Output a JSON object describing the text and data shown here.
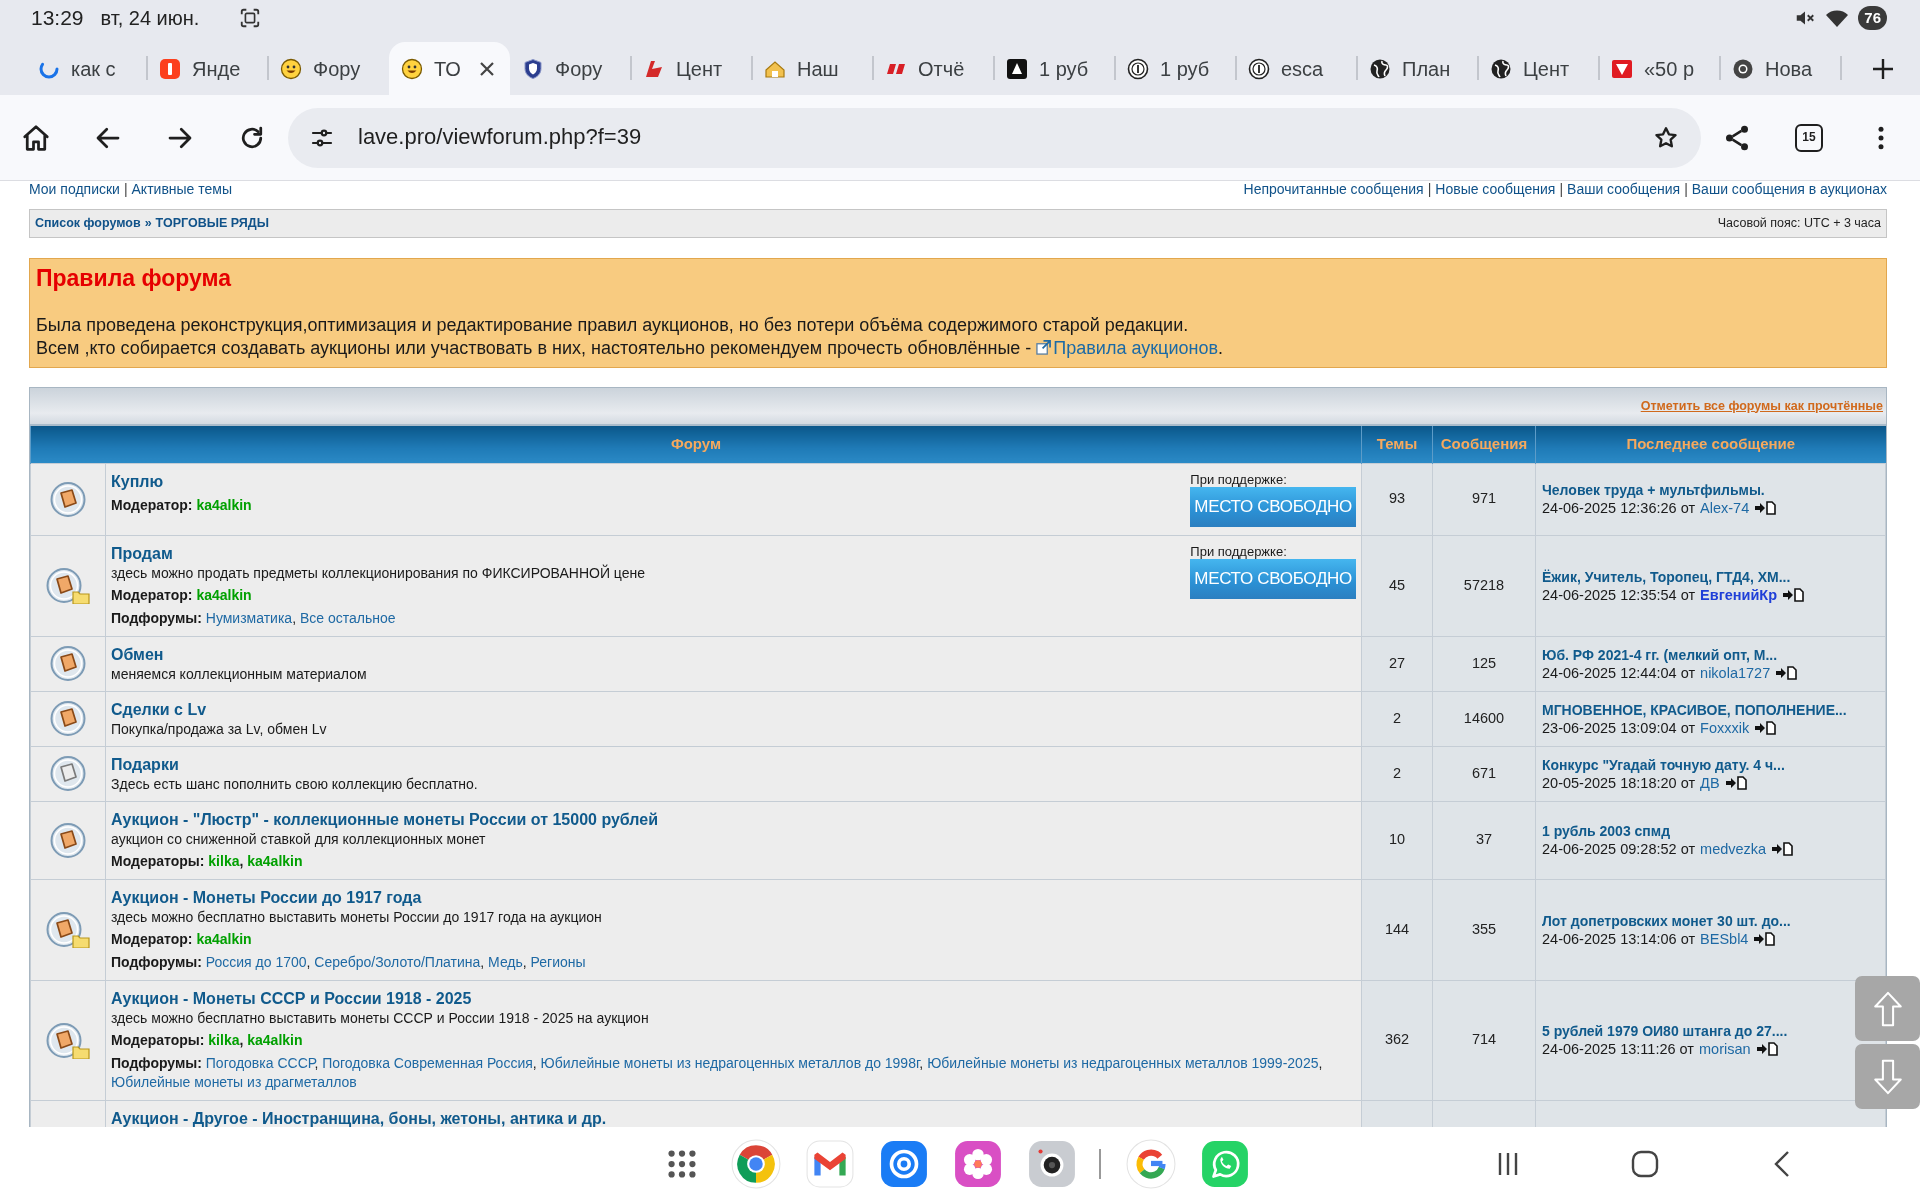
{
  "status_bar": {
    "time": "13:29",
    "date": "вт, 24 июн.",
    "battery": "76"
  },
  "browser": {
    "tabs": [
      {
        "title": "как с",
        "kind": "spinner",
        "selected": false
      },
      {
        "title": "Янде",
        "kind": "red_tile",
        "selected": false
      },
      {
        "title": "Фору",
        "kind": "smiley",
        "selected": false
      },
      {
        "title": "ТО",
        "kind": "smiley",
        "selected": true
      },
      {
        "title": "Фору",
        "kind": "shield",
        "selected": false
      },
      {
        "title": "Цент",
        "kind": "emblem",
        "selected": false
      },
      {
        "title": "Наш",
        "kind": "house",
        "selected": false
      },
      {
        "title": "Отчё",
        "kind": "bars_logo",
        "selected": false
      },
      {
        "title": "1 руб",
        "kind": "dark_tile",
        "selected": false
      },
      {
        "title": "1 руб",
        "kind": "coin",
        "selected": false
      },
      {
        "title": "esca",
        "kind": "coin",
        "selected": false
      },
      {
        "title": "План",
        "kind": "globe",
        "selected": false
      },
      {
        "title": "Цент",
        "kind": "globe",
        "selected": false
      },
      {
        "title": "«50 р",
        "kind": "red_logo",
        "selected": false
      },
      {
        "title": "Нова",
        "kind": "ring_logo",
        "selected": false
      }
    ],
    "url": "lave.pro/viewforum.php?f=39",
    "tab_count": "15"
  },
  "top_links": {
    "left": [
      "Мои подписки",
      "Активные темы"
    ],
    "right": [
      "Непрочитанные сообщения",
      "Новые сообщения",
      "Ваши сообщения",
      "Ваши сообщения в аукционах"
    ],
    "separator": "|"
  },
  "breadcrumb": {
    "items": [
      "Список форумов",
      "ТОРГОВЫЕ РЯДЫ"
    ],
    "separator": "»",
    "timezone": "Часовой пояс: UTC + 3 часа"
  },
  "rules": {
    "title": "Правила форума",
    "paragraphs": [
      {
        "text": "Была проведена реконструкция,оптимизация и редактирование правил аукционов, но без потери объёма содержимого старой редакции."
      },
      {
        "text": "Всем ,кто собирается создавать аукционы или участвовать в них, настоятельно рекомендуем прочесть обновлённые - ",
        "link": "Правила аукционов",
        "after": "."
      }
    ]
  },
  "forum_table": {
    "mark_read": "Отметить все форумы как прочтённые",
    "columns": [
      "Форум",
      "Темы",
      "Сообщения",
      "Последнее сообщение"
    ],
    "separator": ",",
    "rows": [
      {
        "title": "Куплю",
        "unread": true,
        "moderators": {
          "label": "Модератор:",
          "names": [
            "ka4alkin"
          ]
        },
        "sponsor": {
          "label": "При поддержке:",
          "banner": "МЕСТО СВОБОДНО"
        },
        "topics": "93",
        "posts": "971",
        "last_post": {
          "title": "Человек труда + мультфильмы.",
          "time": "24-06-2025 12:36:26 от",
          "author": {
            "name": "Alex-74"
          }
        }
      },
      {
        "title": "Продам",
        "unread": true,
        "description": "здесь можно продать предметы коллекционирования по ФИКСИРОВАННОЙ цене",
        "moderators": {
          "label": "Модератор:",
          "names": [
            "ka4alkin"
          ]
        },
        "subforums": {
          "label": "Подфорумы:",
          "names": [
            "Нумизматика",
            "Все остальное"
          ]
        },
        "sponsor": {
          "label": "При поддержке:",
          "banner": "МЕСТО СВОБОДНО"
        },
        "topics": "45",
        "posts": "57218",
        "last_post": {
          "title": "Ёжик, Учитель, Торопец, ГТД4, ХМ...",
          "time": "24-06-2025 12:35:54 от",
          "author": {
            "name": "ЕвгенийКр",
            "color": "#1f3fd8"
          }
        }
      },
      {
        "title": "Обмен",
        "unread": true,
        "description": "меняемся коллекционным материалом",
        "topics": "27",
        "posts": "125",
        "last_post": {
          "title": "Юб. РФ 2021-4 гг. (мелкий опт, М...",
          "time": "24-06-2025 12:44:04 от",
          "author": {
            "name": "nikola1727"
          }
        }
      },
      {
        "title": "Сделки с Lv",
        "unread": true,
        "description": "Покупка/продажа за Lv, обмен Lv",
        "topics": "2",
        "posts": "14600",
        "last_post": {
          "title": "МГНОВЕННОЕ, КРАСИВОЕ, ПОПОЛНЕНИЕ...",
          "time": "23-06-2025 13:09:04 от",
          "author": {
            "name": "Foxxxik"
          }
        }
      },
      {
        "title": "Подарки",
        "unread": false,
        "description": "Здесь есть шанс пополнить свою коллекцию бесплатно.",
        "topics": "2",
        "posts": "671",
        "last_post": {
          "title": "Конкурс \"Угадай точную дату. 4 ч...",
          "time": "20-05-2025 18:18:20 от",
          "author": {
            "name": "ДВ"
          }
        }
      },
      {
        "title": "Аукцион - \"Люстр\" - коллекционные монеты России от 15000 рублей",
        "unread": true,
        "description": "аукцион со сниженной ставкой для коллекционных монет",
        "moderators": {
          "label": "Модераторы:",
          "names": [
            "kilka",
            "ka4alkin"
          ]
        },
        "topics": "10",
        "posts": "37",
        "last_post": {
          "title": "1 рубль 2003 спмд",
          "time": "24-06-2025 09:28:52 от",
          "author": {
            "name": "medvezka"
          }
        }
      },
      {
        "title": "Аукцион - Монеты России до 1917 года",
        "unread": true,
        "description": "здесь можно бесплатно выставить монеты России до 1917 года на аукцион",
        "moderators": {
          "label": "Модератор:",
          "names": [
            "ka4alkin"
          ]
        },
        "subforums": {
          "label": "Подфорумы:",
          "names": [
            "Россия до 1700",
            "Серебро/Золото/Платина",
            "Медь",
            "Регионы"
          ]
        },
        "topics": "144",
        "posts": "355",
        "last_post": {
          "title": "Лот допетровских монет 30 шт. до...",
          "time": "24-06-2025 13:14:06 от",
          "author": {
            "name": "BESbl4"
          }
        }
      },
      {
        "title": "Аукцион - Монеты СССР и России 1918 - 2025",
        "unread": true,
        "description": "здесь можно бесплатно выставить монеты СССР и России 1918 - 2025 на аукцион",
        "moderators": {
          "label": "Модераторы:",
          "names": [
            "kilka",
            "ka4alkin"
          ]
        },
        "subforums": {
          "label": "Подфорумы:",
          "names": [
            "Погодовка СССР",
            "Погодовка Современная Россия",
            "Юбилейные монеты из недрагоценных металлов до 1998г",
            "Юбилейные монеты из недрагоценных металлов 1999-2025",
            "Юбилейные монеты из драгметаллов"
          ]
        },
        "topics": "362",
        "posts": "714",
        "last_post": {
          "title": "5 рублей 1979 ОИ80 штанга до 27....",
          "time": "24-06-2025 13:11:26 от",
          "author": {
            "name": "morisan"
          }
        }
      },
      {
        "title": "Аукцион - Другое - Иностранщина, боны, жетоны, антика и др."
      }
    ]
  }
}
